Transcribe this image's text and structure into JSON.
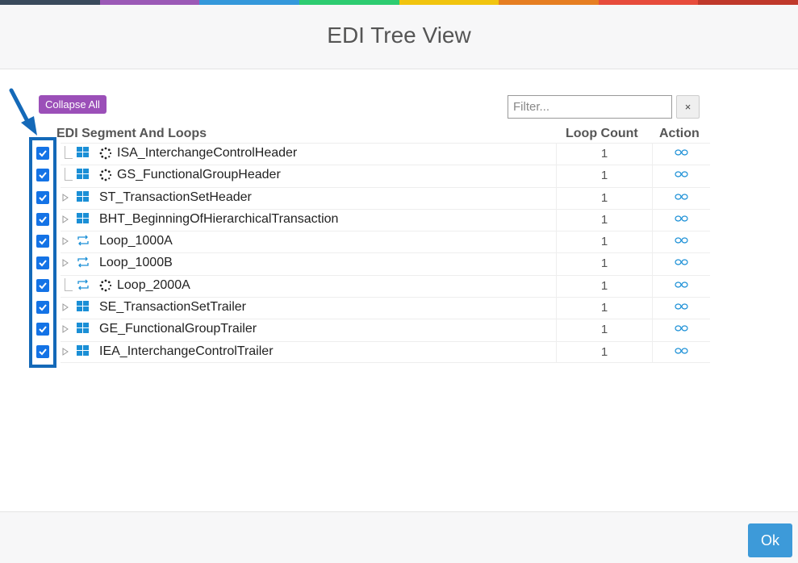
{
  "colors": {
    "stripe": [
      "#3a4a5c",
      "#9b59b6",
      "#3498db",
      "#2ecc71",
      "#f1c40f",
      "#e67e22",
      "#e74c3c",
      "#c0392b"
    ],
    "checkbox": "#1473e6",
    "icon": "#1a8fd6",
    "collapse_button": "#9b4fb8",
    "ok_button": "#3d9ad9",
    "highlight": "#1469b8"
  },
  "dialog": {
    "title": "EDI Tree View"
  },
  "toolbar": {
    "collapse_all_label": "Collapse All",
    "filter_placeholder": "Filter...",
    "filter_value": "",
    "clear_label": "×"
  },
  "columns": {
    "segment": "EDI Segment And Loops",
    "loop_count": "Loop Count",
    "action": "Action"
  },
  "rows": [
    {
      "label": "ISA_InterchangeControlHeader",
      "count": "1",
      "icon": "segment-icon",
      "loading": true,
      "expandable": false,
      "checked": true
    },
    {
      "label": "GS_FunctionalGroupHeader",
      "count": "1",
      "icon": "segment-icon",
      "loading": true,
      "expandable": false,
      "checked": true
    },
    {
      "label": "ST_TransactionSetHeader",
      "count": "1",
      "icon": "segment-icon",
      "loading": false,
      "expandable": true,
      "checked": true
    },
    {
      "label": "BHT_BeginningOfHierarchicalTransaction",
      "count": "1",
      "icon": "segment-icon",
      "loading": false,
      "expandable": true,
      "checked": true
    },
    {
      "label": "Loop_1000A",
      "count": "1",
      "icon": "loop-icon",
      "loading": false,
      "expandable": true,
      "checked": true
    },
    {
      "label": "Loop_1000B",
      "count": "1",
      "icon": "loop-icon",
      "loading": false,
      "expandable": true,
      "checked": true
    },
    {
      "label": "Loop_2000A",
      "count": "1",
      "icon": "loop-icon",
      "loading": true,
      "expandable": false,
      "checked": true
    },
    {
      "label": "SE_TransactionSetTrailer",
      "count": "1",
      "icon": "segment-icon",
      "loading": false,
      "expandable": true,
      "checked": true
    },
    {
      "label": "GE_FunctionalGroupTrailer",
      "count": "1",
      "icon": "segment-icon",
      "loading": false,
      "expandable": true,
      "checked": true
    },
    {
      "label": "IEA_InterchangeControlTrailer",
      "count": "1",
      "icon": "segment-icon",
      "loading": false,
      "expandable": true,
      "checked": true
    }
  ],
  "footer": {
    "ok_label": "Ok"
  }
}
